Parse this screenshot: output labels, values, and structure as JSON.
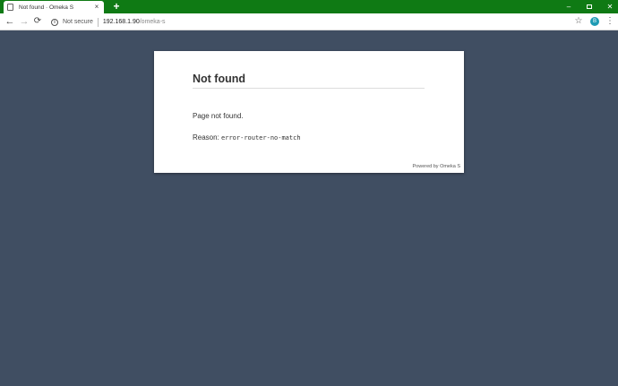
{
  "browser": {
    "tab": {
      "title": "Not found · Omeka S",
      "close": "×"
    },
    "new_tab": "+",
    "window": {
      "minimize": "–",
      "close": "✕"
    },
    "nav": {
      "back": "←",
      "forward": "→",
      "reload": "⟳"
    },
    "address": {
      "info": "i",
      "security": "Not secure",
      "host": "192.168.1.90",
      "path": "/omeka-s"
    },
    "star": "☆",
    "profile_initial": "B",
    "menu": "⋮"
  },
  "page": {
    "title": "Not found",
    "message": "Page not found.",
    "reason_label": "Reason: ",
    "reason_code": "error-router-no-match",
    "footer": "Powered by Omeka S"
  },
  "colors": {
    "titlebar": "#0f7a14",
    "page_background": "#404e62",
    "card": "#ffffff"
  }
}
